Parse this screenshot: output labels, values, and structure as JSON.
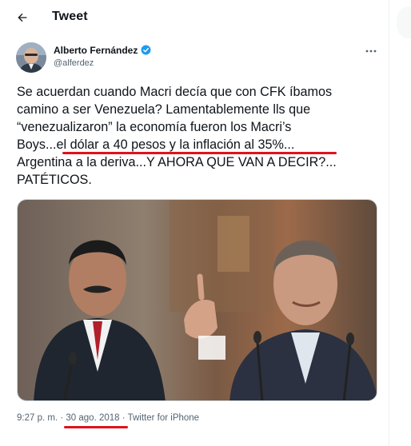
{
  "header": {
    "title": "Tweet"
  },
  "author": {
    "name": "Alberto Fernández",
    "handle": "@alferdez"
  },
  "tweet": {
    "lines": [
      "Se acuerdan cuando Macri decía que con CFK íbamos",
      "camino a ser Venezuela? Lamentablemente lls que",
      "“venezualizaron” la economía fueron los Macri’s",
      "el dólar a 40 pesos y la inflación al 35%...",
      "Argentina a la deriva...Y AHORA QUE VAN A DECIR?...",
      "PATÉTICOS."
    ],
    "line4_prefix": "Boys...",
    "time": "9:27 p. m.",
    "separator": "·",
    "date": "30 ago. 2018",
    "source": "Twitter for iPhone"
  },
  "colors": {
    "annotation_red": "#e0121b",
    "verified_blue": "#1d9bf0",
    "text": "#0f1419",
    "muted": "#536471"
  },
  "icons": {
    "back": "arrow-left-icon",
    "verified": "verified-badge-icon",
    "more": "more-horizontal-icon"
  }
}
